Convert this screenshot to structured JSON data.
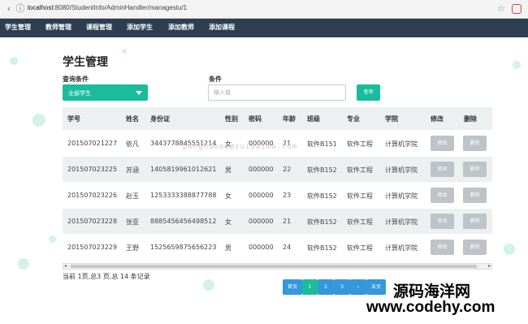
{
  "browser": {
    "url_host": "localhost",
    "url_rest": ":8080/StudentInfo/AdminHandler/managestu/1"
  },
  "nav": {
    "items": [
      "学生管理",
      "教师管理",
      "课程管理",
      "添加学生",
      "添加教师",
      "添加课程"
    ]
  },
  "page": {
    "title": "学生管理",
    "query_label": "查询条件",
    "condition_label": "条件",
    "select_value": "全部学生",
    "input_placeholder": "输入值",
    "search_button": "查询"
  },
  "table": {
    "columns": [
      "学号",
      "姓名",
      "身份证",
      "性别",
      "密码",
      "年龄",
      "班级",
      "专业",
      "学院",
      "修改",
      "删除"
    ],
    "rows": [
      [
        "201507021227",
        "依凡",
        "3443778845551214",
        "女",
        "000000",
        "21",
        "软件B151",
        "软件工程",
        "计算机学院"
      ],
      [
        "201507023225",
        "苏涵",
        "1405819961012621",
        "男",
        "000000",
        "22",
        "软件B152",
        "软件工程",
        "计算机学院"
      ],
      [
        "201507023226",
        "赵玉",
        "1253333388877788",
        "女",
        "000000",
        "23",
        "软件B152",
        "软件工程",
        "计算机学院"
      ],
      [
        "201507023228",
        "张亚",
        "8885456456498512",
        "女",
        "000000",
        "21",
        "软件B152",
        "软件工程",
        "计算机学院"
      ],
      [
        "201507023229",
        "王野",
        "1525659875656223",
        "男",
        "000000",
        "24",
        "软件B152",
        "软件工程",
        "计算机学院"
      ]
    ],
    "edit_label": "修改",
    "delete_label": "删除"
  },
  "pagination": {
    "summary": "当前 1页,总3 页,总 14 条记录",
    "first": "首页",
    "pages": [
      "1",
      "2",
      "3"
    ],
    "next": "›",
    "last": "末页",
    "current_page": 1
  },
  "watermark": "penghoooo@zuidaima.com",
  "brand": {
    "name": "源码海洋网",
    "url": "www.codehy.com"
  },
  "colors": {
    "nav_bg": "#2c3e50",
    "accent": "#1abc9c",
    "pager": "#3498db",
    "disabled_btn": "#bdc3c7",
    "row_alt": "#ecf0f1"
  }
}
